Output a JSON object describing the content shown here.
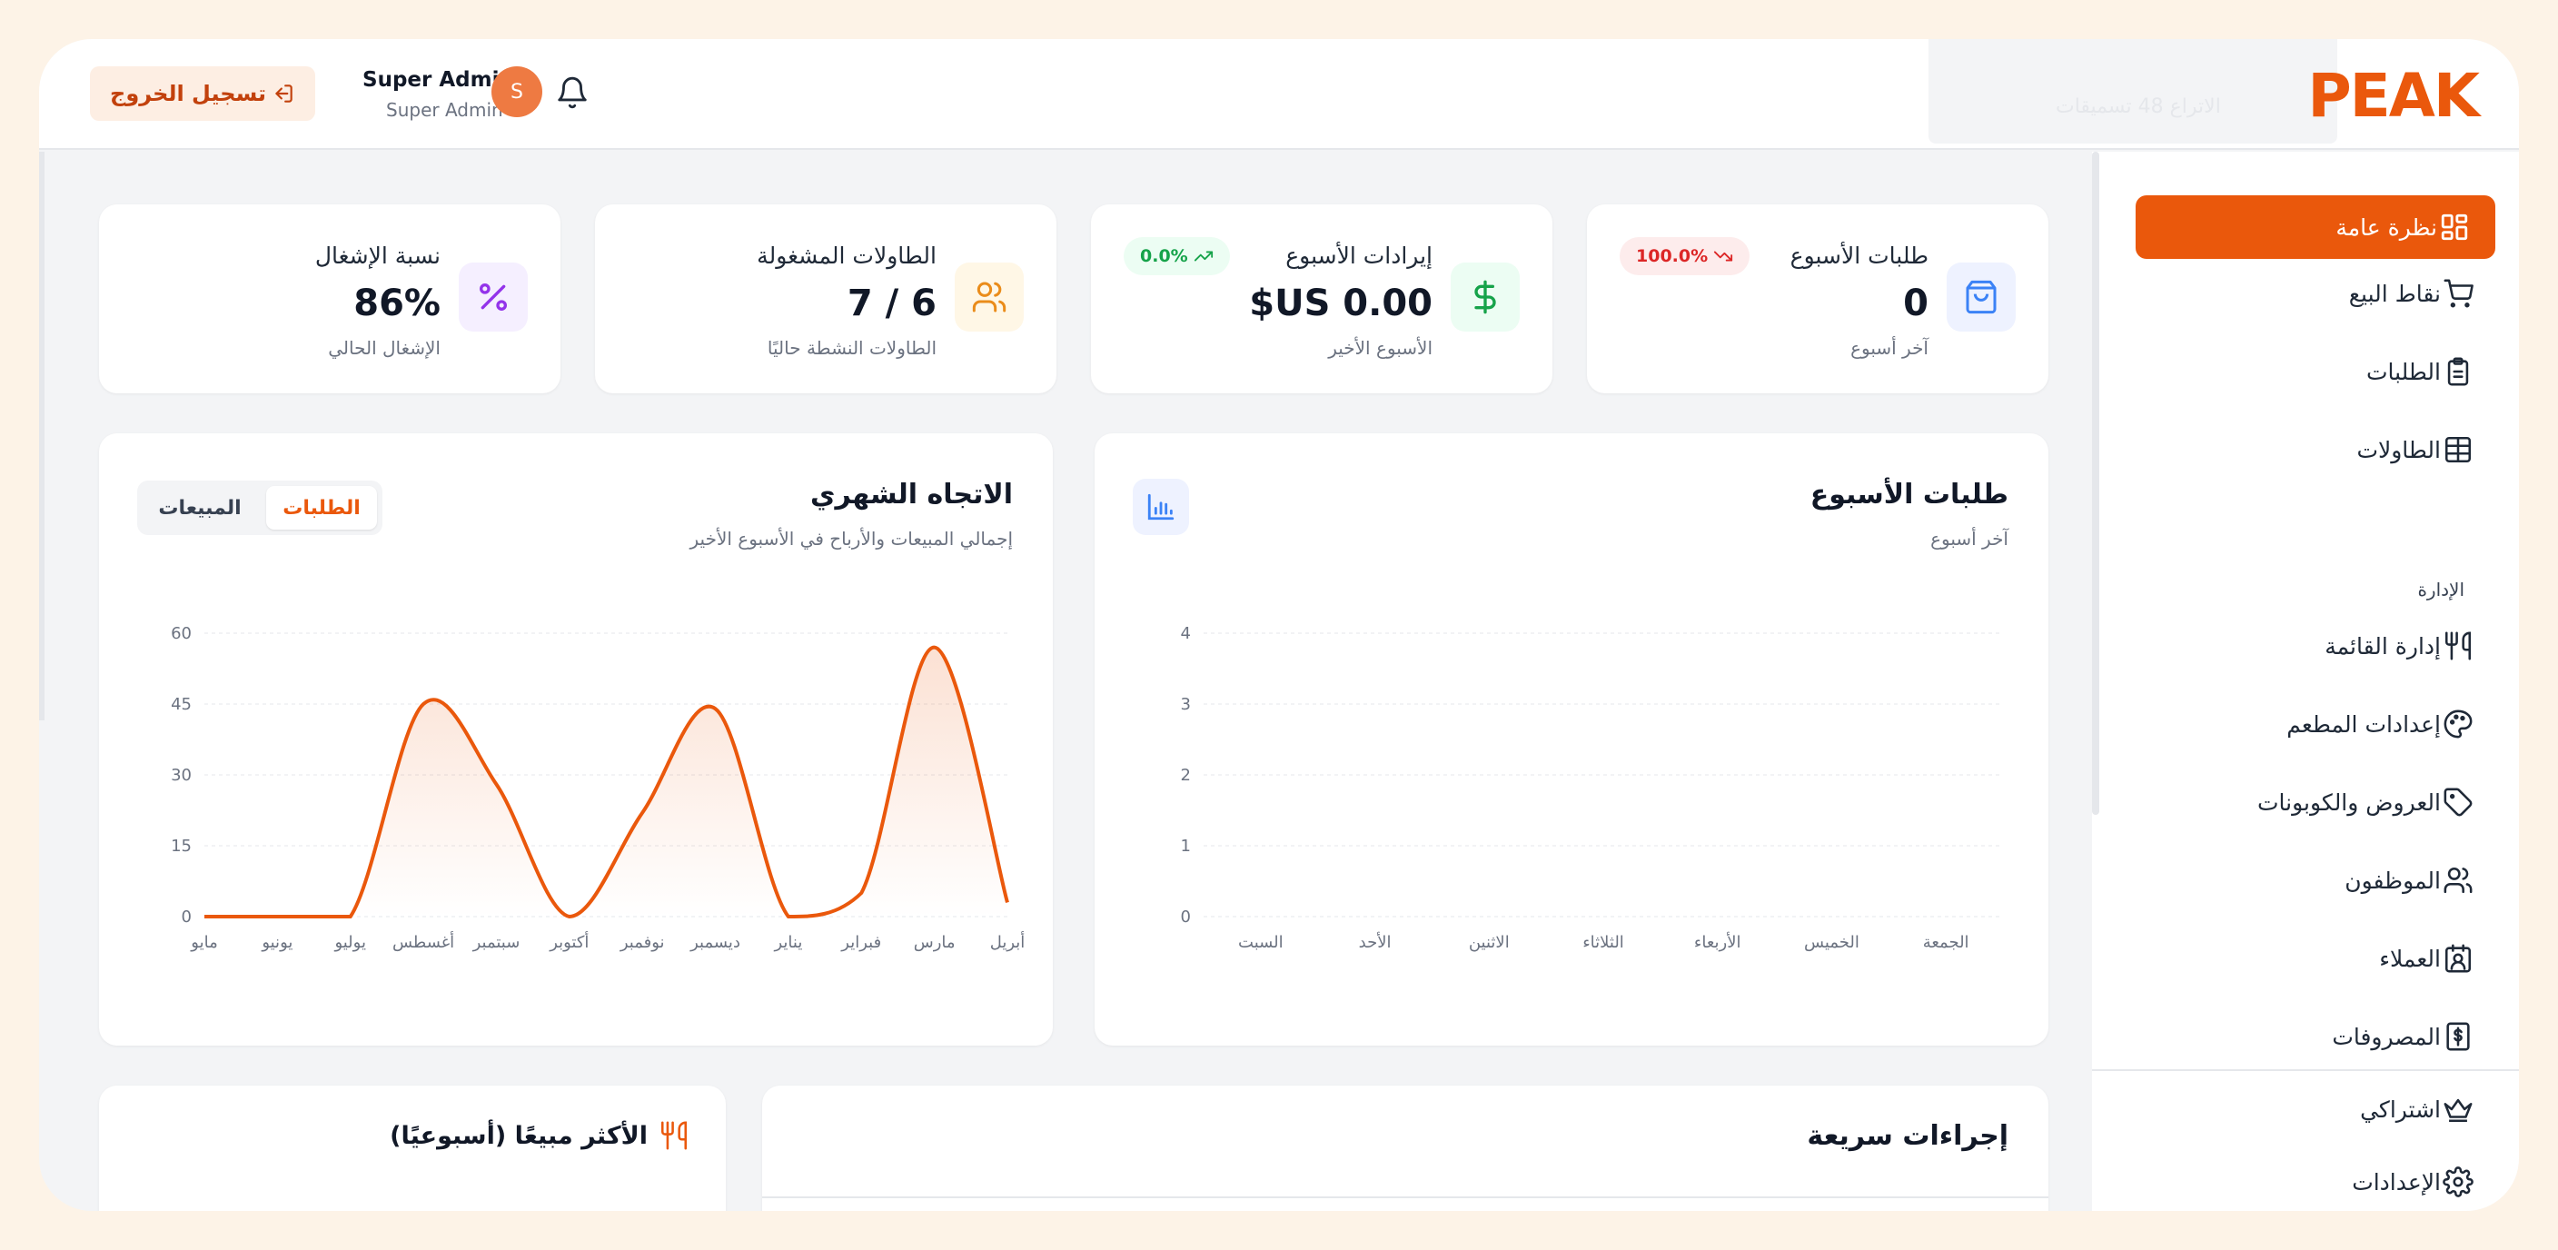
{
  "header": {
    "logo": "PEAK",
    "ghost_text": "الاتراع 48 تسميقات",
    "logout_label": "تسجيل الخروج",
    "user_name": "Super Admin",
    "user_role": "Super Admin",
    "avatar_initial": "S"
  },
  "sidebar": {
    "items": [
      {
        "label": "نظرة عامة",
        "icon": "dashboard-icon",
        "active": true
      },
      {
        "label": "نقاط البيع",
        "icon": "cart-icon"
      },
      {
        "label": "الطلبات",
        "icon": "clipboard-icon"
      },
      {
        "label": "الطاولات",
        "icon": "table-icon"
      }
    ],
    "section_admin": "الإدارة",
    "admin_items": [
      {
        "label": "إدارة القائمة",
        "icon": "utensils-icon"
      },
      {
        "label": "إعدادات المطعم",
        "icon": "palette-icon"
      },
      {
        "label": "العروض والكوبونات",
        "icon": "tag-icon"
      },
      {
        "label": "الموظفون",
        "icon": "users-icon"
      },
      {
        "label": "العملاء",
        "icon": "contact-icon"
      },
      {
        "label": "المصروفات",
        "icon": "receipt-icon"
      }
    ],
    "bottom_items": [
      {
        "label": "اشتراكي",
        "icon": "crown-icon"
      },
      {
        "label": "الإعدادات",
        "icon": "gear-icon"
      }
    ]
  },
  "stats": [
    {
      "title": "طلبات الأسبوع",
      "value": "0",
      "sub": "آخر أسبوع",
      "badge": "100.0%",
      "icon": "shopping-bag-icon"
    },
    {
      "title": "إيرادات الأسبوع",
      "value": "$US 0.00",
      "sub": "الأسبوع الأخير",
      "badge": "0.0%",
      "icon": "dollar-icon"
    },
    {
      "title": "الطاولات المشغولة",
      "value": "7 / 6",
      "sub": "الطاولات النشطة حاليًا",
      "icon": "users-icon"
    },
    {
      "title": "نسبة الإشغال",
      "value": "86%",
      "sub": "الإشغال الحالي",
      "icon": "percent-icon"
    }
  ],
  "weekly_chart": {
    "title": "طلبات الأسبوع",
    "subtitle": "آخر أسبوع"
  },
  "monthly_chart": {
    "title": "الاتجاه الشهري",
    "subtitle": "إجمالي المبيعات والأرباح في الأسبوع الأخير",
    "toggle_orders": "الطلبات",
    "toggle_sales": "المبيعات"
  },
  "quick_actions": {
    "title": "إجراءات سريعة"
  },
  "top_selling": {
    "title": "الأكثر مبيعًا (أسبوعيًا)"
  },
  "colors": {
    "accent": "#ea580c",
    "badge_down": "#dc2626",
    "badge_up": "#16a34a"
  },
  "chart_data": [
    {
      "type": "bar",
      "title": "طلبات الأسبوع",
      "categories": [
        "الجمعة",
        "الخميس",
        "الأربعاء",
        "الثلاثاء",
        "الاثنين",
        "الأحد",
        "السبت"
      ],
      "values": [
        0,
        0,
        0,
        0,
        0,
        0,
        0
      ],
      "ylim": [
        0,
        4
      ],
      "yticks": [
        "0",
        "1",
        "2",
        "3",
        "4"
      ],
      "grid": true
    },
    {
      "type": "area",
      "title": "الاتجاه الشهري",
      "categories": [
        "أبريل",
        "مارس",
        "فبراير",
        "يناير",
        "ديسمبر",
        "نوفمبر",
        "أكتوبر",
        "سبتمبر",
        "أغسطس",
        "يوليو",
        "يونيو",
        "مايو"
      ],
      "values": [
        3,
        57,
        5,
        0,
        44,
        22,
        0,
        28,
        45,
        0,
        0,
        0
      ],
      "ylim": [
        0,
        60
      ],
      "yticks": [
        "0",
        "15",
        "30",
        "45",
        "60"
      ],
      "grid": true
    }
  ]
}
